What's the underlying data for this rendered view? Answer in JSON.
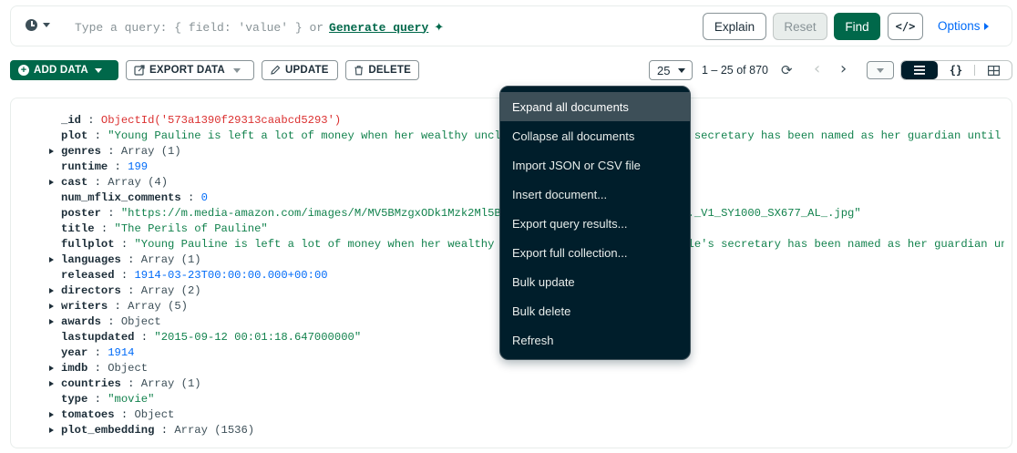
{
  "query_bar": {
    "placeholder_text": "Type a query: { field: 'value' } or",
    "generate_link": "Generate query",
    "sparkle": "✦",
    "buttons": {
      "explain": "Explain",
      "reset": "Reset",
      "find": "Find",
      "code": "</>"
    },
    "options_label": "Options"
  },
  "toolbar": {
    "add_data": "ADD DATA",
    "export_data": "EXPORT DATA",
    "update": "UPDATE",
    "delete": "DELETE",
    "page_size": "25",
    "range": "1 – 25 of 870",
    "view_icons": [
      "list-icon",
      "json-icon",
      "table-icon"
    ]
  },
  "document": {
    "fields": [
      {
        "key": "_id",
        "value": "ObjectId('573a1390f29313caabcd5293')",
        "type": "oid",
        "expandable": false
      },
      {
        "key": "plot",
        "value": "\"Young Pauline is left a lot of money when her wealthy uncle dies. However, her uncle's secretary has been named as her guardian until she marries, at which time she will officially take ...\"",
        "type": "str",
        "expandable": false
      },
      {
        "key": "genres",
        "value": "Array (1)",
        "type": "type",
        "expandable": true
      },
      {
        "key": "runtime",
        "value": "199",
        "type": "num",
        "expandable": false
      },
      {
        "key": "cast",
        "value": "Array (4)",
        "type": "type",
        "expandable": true
      },
      {
        "key": "num_mflix_comments",
        "value": "0",
        "type": "num",
        "expandable": false
      },
      {
        "key": "poster",
        "value": "\"https://m.media-amazon.com/images/M/MV5BMzgxODk1Mzk2Ml5BMl5BanBnXkFtZTgwMDg0NzkwMjE@._V1_SY1000_SX677_AL_.jpg\"",
        "type": "str",
        "expandable": false
      },
      {
        "key": "title",
        "value": "\"The Perils of Pauline\"",
        "type": "str",
        "expandable": false
      },
      {
        "key": "fullplot",
        "value": "\"Young Pauline is left a lot of money when her wealthy uncle dies. However, her uncle's secretary has been named as her guardian until she marries ...\"",
        "type": "str",
        "expandable": false
      },
      {
        "key": "languages",
        "value": "Array (1)",
        "type": "type",
        "expandable": true
      },
      {
        "key": "released",
        "value": "1914-03-23T00:00:00.000+00:00",
        "type": "date",
        "expandable": false
      },
      {
        "key": "directors",
        "value": "Array (2)",
        "type": "type",
        "expandable": true
      },
      {
        "key": "writers",
        "value": "Array (5)",
        "type": "type",
        "expandable": true
      },
      {
        "key": "awards",
        "value": "Object",
        "type": "type",
        "expandable": true
      },
      {
        "key": "lastupdated",
        "value": "\"2015-09-12 00:01:18.647000000\"",
        "type": "str",
        "expandable": false
      },
      {
        "key": "year",
        "value": "1914",
        "type": "num",
        "expandable": false
      },
      {
        "key": "imdb",
        "value": "Object",
        "type": "type",
        "expandable": true
      },
      {
        "key": "countries",
        "value": "Array (1)",
        "type": "type",
        "expandable": true
      },
      {
        "key": "type",
        "value": "\"movie\"",
        "type": "str",
        "expandable": false
      },
      {
        "key": "tomatoes",
        "value": "Object",
        "type": "type",
        "expandable": true
      },
      {
        "key": "plot_embedding",
        "value": "Array (1536)",
        "type": "type",
        "expandable": true
      }
    ]
  },
  "menu": {
    "items": [
      "Expand all documents",
      "Collapse all documents",
      "Import JSON or CSV file",
      "Insert document...",
      "Export query results...",
      "Export full collection...",
      "Bulk update",
      "Bulk delete",
      "Refresh"
    ],
    "hovered_index": 0
  },
  "colors": {
    "primary_green": "#00684a",
    "menu_bg": "#001e2b",
    "link_blue": "#016bf8",
    "string_green": "#12824d",
    "objectid_red": "#db3030"
  }
}
